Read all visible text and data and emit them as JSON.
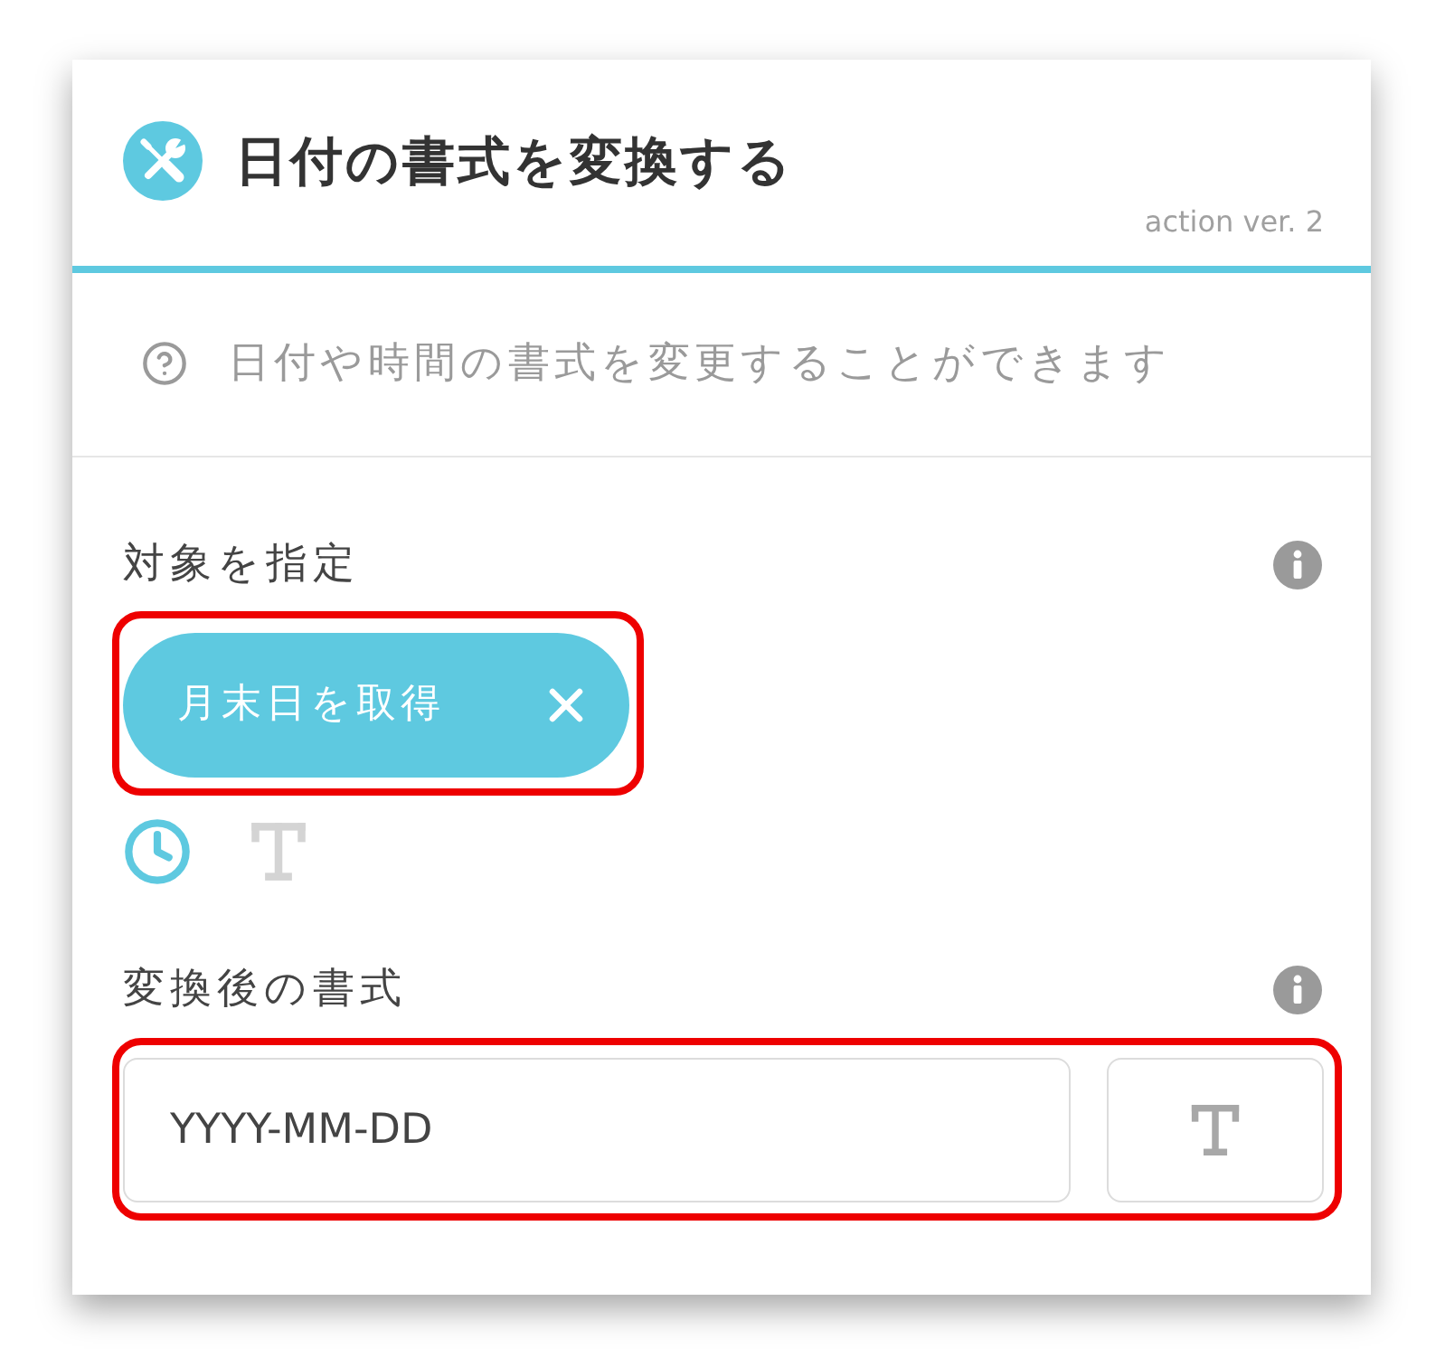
{
  "header": {
    "title": "日付の書式を変換する",
    "version": "action ver. 2"
  },
  "description": "日付や時間の書式を変更することができます",
  "fields": [
    {
      "kind": "chip",
      "label": "対象を指定",
      "highlighted": true,
      "chip": "月末日を取得",
      "modes": [
        {
          "kind": "time",
          "selected": true
        },
        {
          "kind": "text",
          "selected": false
        }
      ]
    },
    {
      "kind": "input",
      "label": "変換後の書式",
      "highlighted": true,
      "value": "YYYY-MM-DD"
    }
  ]
}
